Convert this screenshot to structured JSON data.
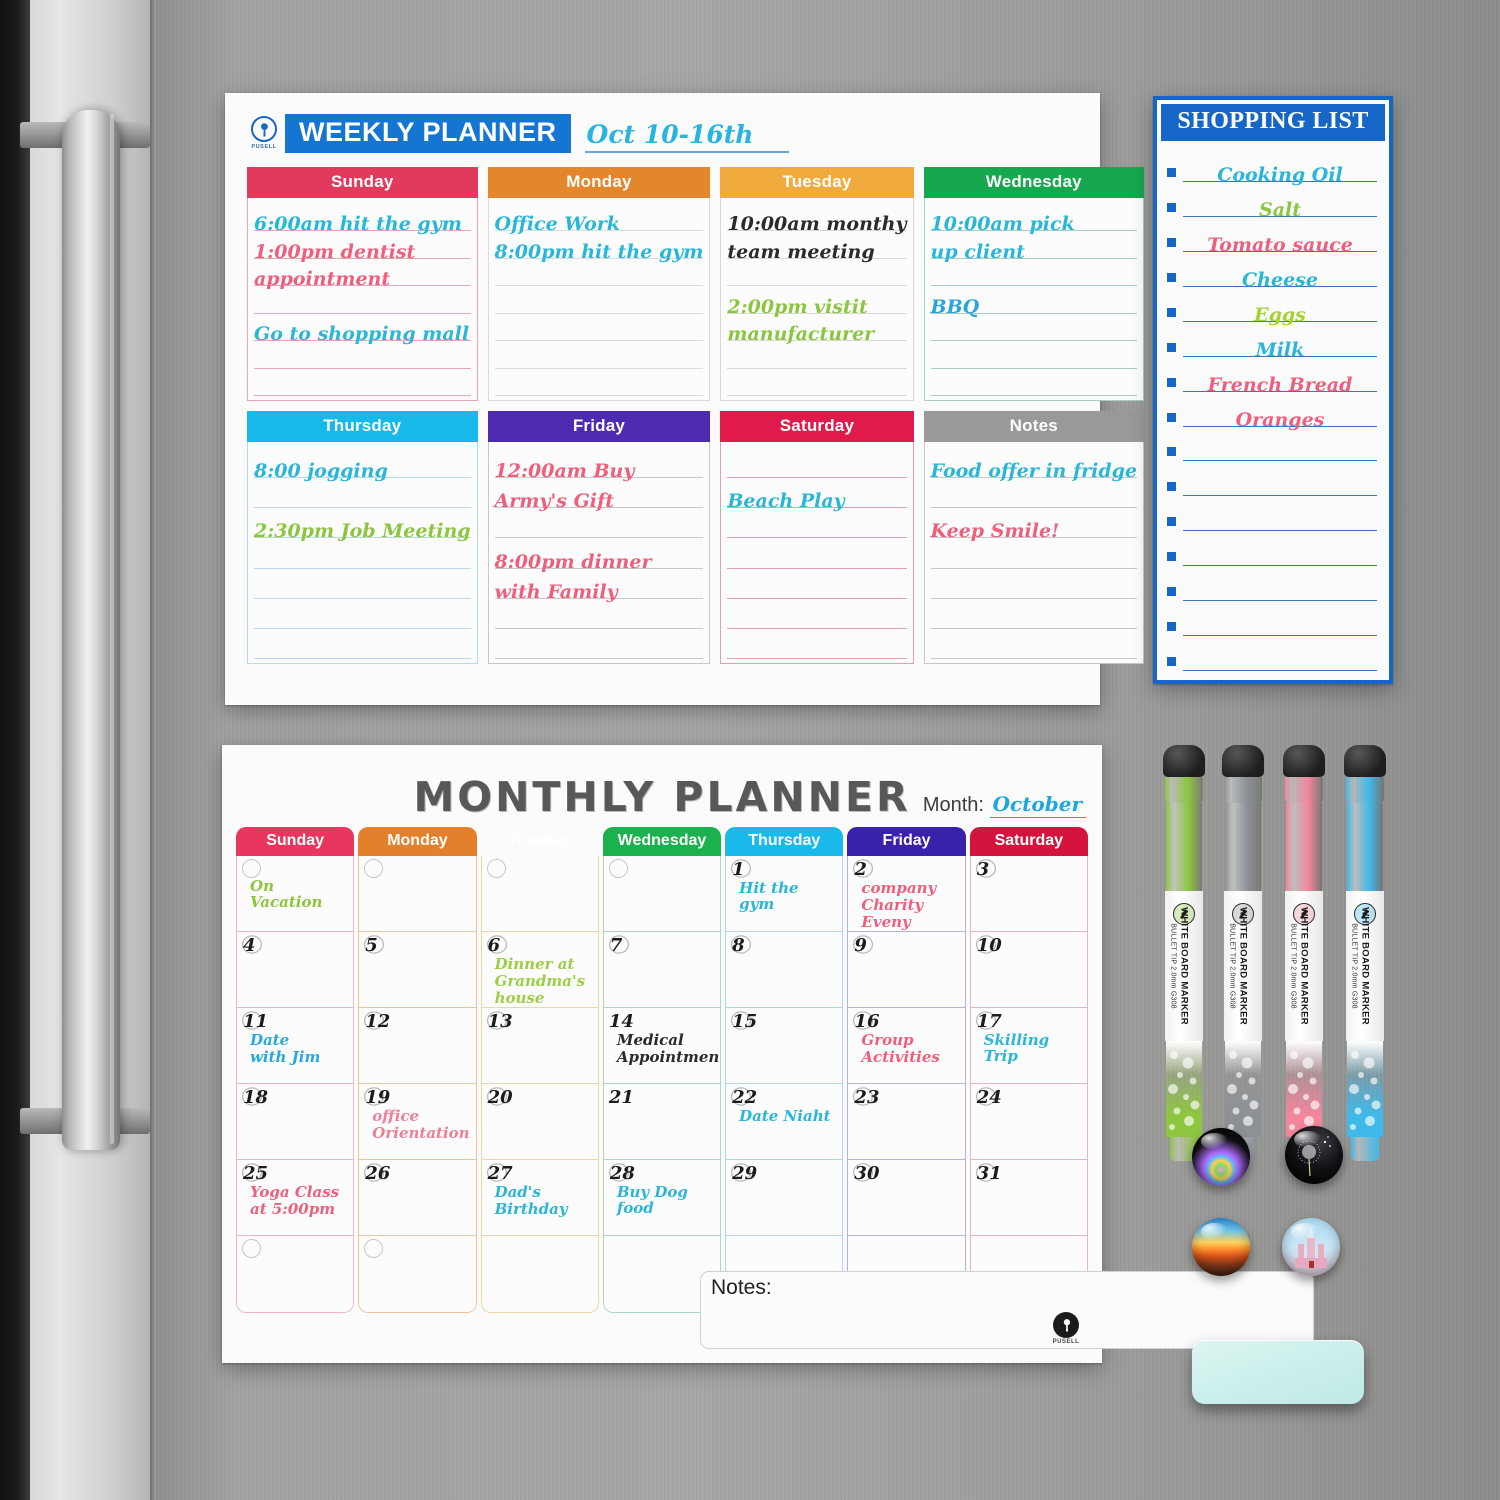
{
  "brand": {
    "logo_name": "PUSELL",
    "logo_icon": "pusell-tree-logo-icon"
  },
  "weekly_planner": {
    "title": "WEEKLY PLANNER",
    "date_range": "Oct 10-16th",
    "title_bg": "#1476d2",
    "days": [
      {
        "name": "Sunday",
        "header_color": "#e13a5c",
        "line_color": "#e3a9b6",
        "entries": [
          "6:00am hit the gym",
          "1:00pm dentist",
          "appointment",
          "",
          "Go to shopping mall",
          "",
          ""
        ],
        "entry_colors": [
          "#29b6d8",
          "#ef5f7c",
          "#ef5f7c",
          "",
          "#29b6d8",
          "",
          ""
        ]
      },
      {
        "name": "Monday",
        "header_color": "#e4862c",
        "line_color": "#dcdcdc",
        "entries": [
          "Office Work",
          "8:00pm hit the gym",
          "",
          "",
          "",
          "",
          ""
        ],
        "entry_colors": [
          "#29b6d8",
          "#29b6d8",
          "",
          "",
          "",
          "",
          ""
        ]
      },
      {
        "name": "Tuesday",
        "header_color": "#f0ab3c",
        "line_color": "#d8d8d8",
        "entries": [
          "10:00am monthy",
          "team meeting",
          "",
          "2:00pm vistit",
          "manufacturer",
          "",
          ""
        ],
        "entry_colors": [
          "#2b2b2b",
          "#2b2b2b",
          "",
          "#8cc63e",
          "#8cc63e",
          "",
          ""
        ]
      },
      {
        "name": "Wednesday",
        "header_color": "#16a84f",
        "line_color": "#a8cfc0",
        "entries": [
          "10:00am pick",
          "up client",
          "",
          "BBQ",
          "",
          "",
          ""
        ],
        "entry_colors": [
          "#29b6d8",
          "#29b6d8",
          "",
          "#29a4dd",
          "",
          "",
          ""
        ]
      },
      {
        "name": "Thursday",
        "header_color": "#16b9e8",
        "line_color": "#b9d9e8",
        "entries": [
          "8:00 jogging",
          "",
          "2:30pm Job Meeting",
          "",
          "",
          "",
          ""
        ],
        "entry_colors": [
          "#29b6d8",
          "",
          "#8cc63e",
          "",
          "",
          "",
          ""
        ]
      },
      {
        "name": "Friday",
        "header_color": "#4d2bb0",
        "line_color": "#c9c9c9",
        "entries": [
          "12:00am Buy",
          "Army's Gift",
          "",
          "8:00pm dinner",
          "with Family",
          "",
          ""
        ],
        "entry_colors": [
          "#ef5f7c",
          "#ef5f7c",
          "",
          "#ef5f7c",
          "#ef5f7c",
          "",
          ""
        ]
      },
      {
        "name": "Saturday",
        "header_color": "#e01a4a",
        "line_color": "#e3a0ad",
        "entries": [
          "",
          "Beach Play",
          "",
          "",
          "",
          "",
          ""
        ],
        "entry_colors": [
          "",
          "#29b6d8",
          "",
          "",
          "",
          "",
          ""
        ]
      },
      {
        "name": "Notes",
        "header_color": "#999999",
        "line_color": "#c9c9c9",
        "entries": [
          "Food offer in fridge",
          "",
          "Keep Smile!",
          "",
          "",
          "",
          ""
        ],
        "entry_colors": [
          "#29b6d8",
          "",
          "#ef5f7c",
          "",
          "",
          "",
          ""
        ]
      }
    ]
  },
  "shopping_list": {
    "title": "SHOPPING LIST",
    "border_color": "#1566c6",
    "items": [
      {
        "text": "Cooking Oil",
        "color": "#29b6d8"
      },
      {
        "text": "Salt",
        "color": "#8cc63e"
      },
      {
        "text": "Tomato sauce",
        "color": "#ef5f7c"
      },
      {
        "text": "Cheese",
        "color": "#29b6d8"
      },
      {
        "text": "Eggs",
        "color": "#a4d233"
      },
      {
        "text": "Milk",
        "color": "#29b6d8"
      },
      {
        "text": "French Bread",
        "color": "#ef5f7c"
      },
      {
        "text": "Oranges",
        "color": "#ef5f7c"
      },
      {
        "text": "",
        "color": ""
      },
      {
        "text": "",
        "color": ""
      },
      {
        "text": "",
        "color": ""
      },
      {
        "text": "",
        "color": ""
      },
      {
        "text": "",
        "color": ""
      },
      {
        "text": "",
        "color": ""
      },
      {
        "text": "",
        "color": ""
      }
    ]
  },
  "monthly_planner": {
    "title": "MONTHLY PLANNER",
    "month_label": "Month:",
    "month_value": "October",
    "notes_label": "Notes:",
    "columns": [
      {
        "name": "Sunday",
        "header_color": "#e8365f",
        "cell_color": "#f0b6c2",
        "cells": [
          {
            "num": "",
            "circle": true,
            "events": [
              "On Vacation"
            ],
            "color": "#8cc63e"
          },
          {
            "num": "4",
            "circle": true,
            "events": [],
            "color": ""
          },
          {
            "num": "11",
            "circle": true,
            "events": [
              "Date",
              "with Jim"
            ],
            "color": "#29a8db"
          },
          {
            "num": "18",
            "circle": true,
            "events": [],
            "color": ""
          },
          {
            "num": "25",
            "circle": true,
            "events": [
              "Yoga Class",
              "at 5:00pm"
            ],
            "color": "#ef5f7c"
          },
          {
            "num": "",
            "circle": true,
            "events": [],
            "color": ""
          }
        ]
      },
      {
        "name": "Monday",
        "header_color": "#e4802b",
        "cell_color": "#eec49f",
        "cells": [
          {
            "num": "",
            "circle": true,
            "events": [],
            "color": ""
          },
          {
            "num": "5",
            "circle": true,
            "events": [],
            "color": ""
          },
          {
            "num": "12",
            "circle": true,
            "events": [],
            "color": ""
          },
          {
            "num": "19",
            "circle": true,
            "events": [
              "office",
              "Orientation"
            ],
            "color": "#ef7f96"
          },
          {
            "num": "26",
            "circle": true,
            "events": [],
            "color": ""
          },
          {
            "num": "",
            "circle": true,
            "events": [],
            "color": ""
          }
        ]
      },
      {
        "name": "Tuesday",
        "header_color": "#f2b council",
        "cell_color": "#f0d3a6",
        "cells": [
          {
            "num": "",
            "circle": true,
            "events": [],
            "color": ""
          },
          {
            "num": "6",
            "circle": true,
            "events": [
              "Dinner at",
              "Grandma's",
              "house"
            ],
            "color": "#9ccf46"
          },
          {
            "num": "13",
            "circle": true,
            "events": [],
            "color": ""
          },
          {
            "num": "20",
            "circle": true,
            "events": [],
            "color": ""
          },
          {
            "num": "27",
            "circle": true,
            "events": [
              "Dad's",
              "Birthday"
            ],
            "color": "#29b6d8"
          },
          {
            "num": "",
            "circle": false,
            "events": [],
            "color": ""
          }
        ]
      },
      {
        "name": "Wednesday",
        "header_color": "#1cb14f",
        "cell_color": "#a8d9bc",
        "cells": [
          {
            "num": "",
            "circle": true,
            "events": [],
            "color": ""
          },
          {
            "num": "7",
            "circle": true,
            "events": [],
            "color": ""
          },
          {
            "num": "14",
            "circle": false,
            "events": [
              "Medical",
              "Appointment"
            ],
            "color": "#2b2b2b"
          },
          {
            "num": "21",
            "circle": false,
            "events": [],
            "color": ""
          },
          {
            "num": "28",
            "circle": true,
            "events": [
              "Buy Dog food"
            ],
            "color": "#29b6d8"
          },
          {
            "num": "",
            "circle": false,
            "events": [],
            "color": ""
          }
        ]
      },
      {
        "name": "Thursday",
        "header_color": "#19b9ea",
        "cell_color": "#aed5e9",
        "cells": [
          {
            "num": "1",
            "circle": true,
            "events": [
              "Hit the gym"
            ],
            "color": "#29b6d8"
          },
          {
            "num": "8",
            "circle": true,
            "events": [],
            "color": ""
          },
          {
            "num": "15",
            "circle": true,
            "events": [],
            "color": ""
          },
          {
            "num": "22",
            "circle": true,
            "events": [
              "Date Niaht"
            ],
            "color": "#29b6d8"
          },
          {
            "num": "29",
            "circle": true,
            "events": [],
            "color": ""
          },
          {
            "num": "",
            "circle": false,
            "events": [],
            "color": ""
          }
        ]
      },
      {
        "name": "Friday",
        "header_color": "#3a21ab",
        "cell_color": "#b5b0de",
        "cells": [
          {
            "num": "2",
            "circle": true,
            "events": [
              "company",
              "Charity",
              "Eveny"
            ],
            "color": "#ef5f7c"
          },
          {
            "num": "9",
            "circle": true,
            "events": [],
            "color": ""
          },
          {
            "num": "16",
            "circle": true,
            "events": [
              "Group",
              "Activities"
            ],
            "color": "#ef5f7c"
          },
          {
            "num": "23",
            "circle": true,
            "events": [],
            "color": ""
          },
          {
            "num": "30",
            "circle": true,
            "events": [],
            "color": ""
          },
          {
            "num": "",
            "circle": false,
            "events": [],
            "color": ""
          }
        ]
      },
      {
        "name": "Saturday",
        "header_color": "#d4143c",
        "cell_color": "#eeb3c0",
        "cells": [
          {
            "num": "3",
            "circle": true,
            "events": [],
            "color": ""
          },
          {
            "num": "10",
            "circle": true,
            "events": [],
            "color": ""
          },
          {
            "num": "17",
            "circle": true,
            "events": [
              "Skilling Trip"
            ],
            "color": "#29b6d8"
          },
          {
            "num": "24",
            "circle": true,
            "events": [],
            "color": ""
          },
          {
            "num": "31",
            "circle": true,
            "events": [],
            "color": ""
          },
          {
            "num": "",
            "circle": false,
            "events": [],
            "color": ""
          }
        ]
      }
    ]
  },
  "markers": [
    {
      "name": "green-marker",
      "body_color": "#8ec63f",
      "label_line1": "WHITE BOARD",
      "label_line2": "MARKER",
      "label_sub": "BULLET TIP 2.0mm  G308",
      "cap_color": "#222222"
    },
    {
      "name": "grey-marker",
      "body_color": "#8d9196",
      "label_line1": "WHITE BOARD",
      "label_line2": "MARKER",
      "label_sub": "BULLET TIP 2.0mm  G308",
      "cap_color": "#222222"
    },
    {
      "name": "pink-marker",
      "body_color": "#f4869c",
      "label_line1": "WHITE BOARD",
      "label_line2": "MARKER",
      "label_sub": "BULLET TIP 2.0mm  G308",
      "cap_color": "#222222"
    },
    {
      "name": "blue-marker",
      "body_color": "#3fb9ea",
      "label_line1": "WHITE BOARD",
      "label_line2": "MARKER",
      "label_sub": "BULLET TIP 2.0mm  G308",
      "cap_color": "#222222"
    }
  ],
  "magnets": [
    {
      "name": "confetti-glass-magnet",
      "description": "colorful confetti on black"
    },
    {
      "name": "dandelion-glass-magnet",
      "description": "white dandelion on black"
    },
    {
      "name": "sunset-seascape-glass-magnet",
      "description": "orange sunset over water"
    },
    {
      "name": "castle-glass-magnet",
      "description": "fairytale castle on blue sky"
    }
  ],
  "eraser": {
    "name": "magnetic-eraser",
    "color": "#cdefe9"
  }
}
